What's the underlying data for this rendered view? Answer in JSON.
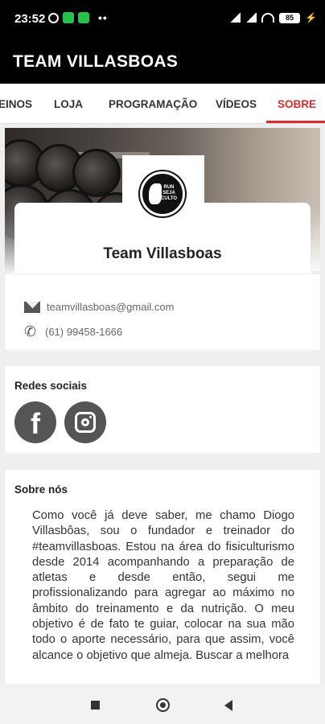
{
  "status_bar": {
    "time": "23:52",
    "dots": "••",
    "battery": "85",
    "icons": [
      "alarm-icon",
      "whatsapp-business-icon",
      "whatsapp-icon",
      "cellular-signal-icon",
      "wifi-icon",
      "battery-icon",
      "charging-icon"
    ]
  },
  "app_bar": {
    "title": "TEAM VILLASBOAS"
  },
  "tabs": [
    {
      "label": "EINOS"
    },
    {
      "label": "LOJA"
    },
    {
      "label": "PROGRAMAÇÃO"
    },
    {
      "label": "VÍDEOS"
    },
    {
      "label": "SOBRE",
      "active": true
    }
  ],
  "profile": {
    "logo_text": "RUN SEJA CULTO",
    "name": "Team Villasboas"
  },
  "contact": {
    "email": "teamvillasboas@gmail.com",
    "phone": "(61) 99458-1666"
  },
  "social": {
    "title": "Redes sociais",
    "facebook_letter": "f"
  },
  "about": {
    "title": "Sobre nós",
    "text": "Como você já deve saber, me chamo Diogo Villasbôas, sou o fundador e treinador do #teamvillasboas. Estou na área do fisiculturismo desde 2014 acompanhando a preparação de atletas e desde então, segui me profissionalizando para agregar ao máximo no âmbito do treinamento e da nutrição. O meu objetivo é de fato te guiar, colocar na sua mão todo o aporte necessário, para que assim, você alcance o objetivo que almeja. Buscar a melhora"
  },
  "colors": {
    "accent": "#d32f2f",
    "header_bg": "#000000",
    "icon_gray": "#555555"
  }
}
